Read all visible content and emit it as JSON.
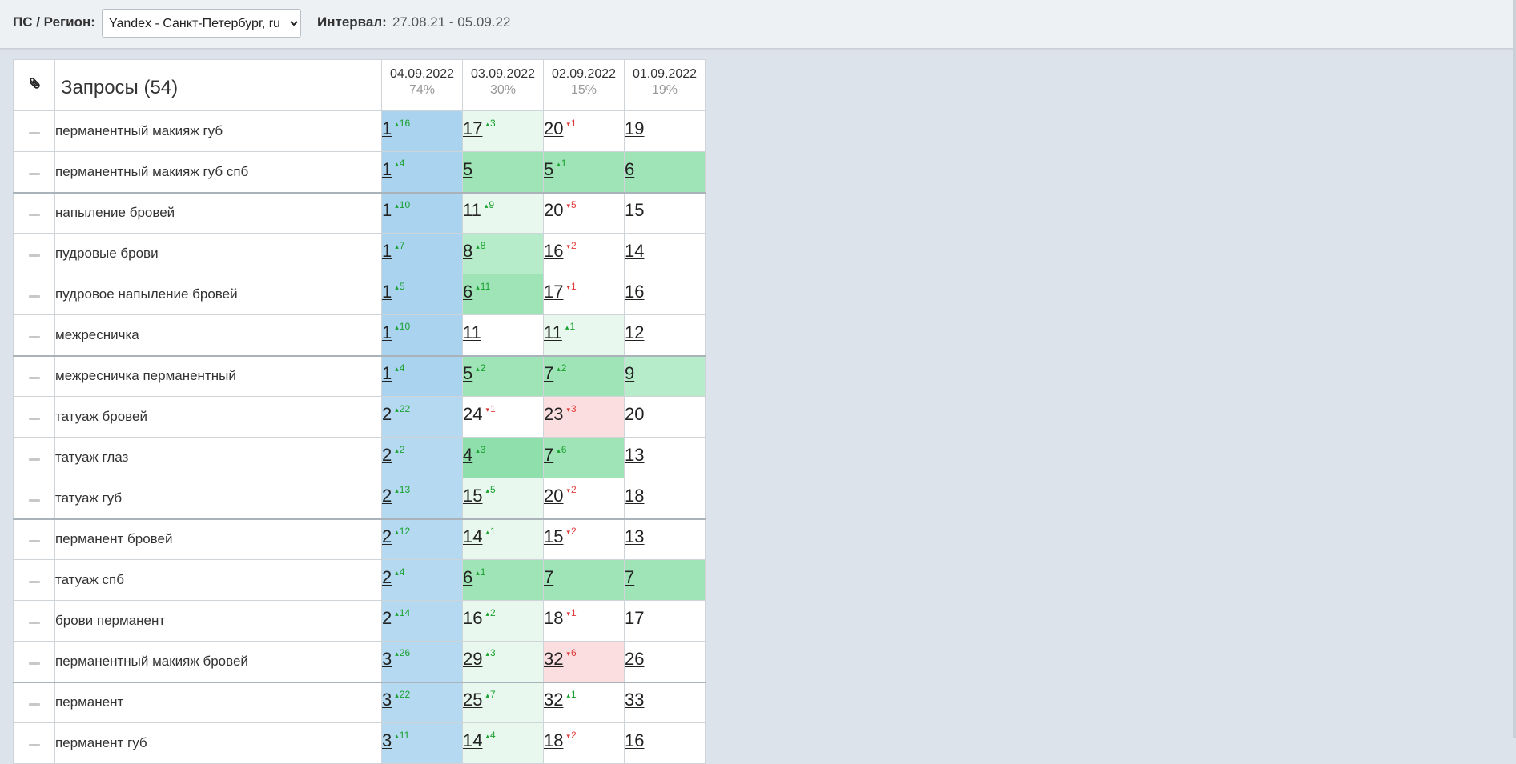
{
  "toolbar": {
    "region_label": "ПС / Регион:",
    "region_value": "Yandex - Санкт-Петербург, ru",
    "interval_label": "Интервал:",
    "interval_value": "27.08.21 - 05.09.22"
  },
  "table": {
    "attach_icon": "paperclip-icon",
    "query_header": "Запросы (54)",
    "columns": [
      {
        "date": "04.09.2022",
        "pct": "74%"
      },
      {
        "date": "03.09.2022",
        "pct": "30%"
      },
      {
        "date": "02.09.2022",
        "pct": "15%"
      },
      {
        "date": "01.09.2022",
        "pct": "19%"
      }
    ],
    "rows": [
      {
        "query": "перманентный макияж губ",
        "group_start": false,
        "cells": [
          {
            "v": "1",
            "d": "16",
            "dir": "up",
            "bg": "top"
          },
          {
            "v": "17",
            "d": "3",
            "dir": "up",
            "bg": "g5"
          },
          {
            "v": "20",
            "d": "1",
            "dir": "dn",
            "bg": "white"
          },
          {
            "v": "19",
            "d": "",
            "dir": "",
            "bg": "white"
          }
        ]
      },
      {
        "query": "перманентный макияж губ спб",
        "group_start": false,
        "cells": [
          {
            "v": "1",
            "d": "4",
            "dir": "up",
            "bg": "top"
          },
          {
            "v": "5",
            "d": "",
            "dir": "",
            "bg": "g2"
          },
          {
            "v": "5",
            "d": "1",
            "dir": "up",
            "bg": "g2"
          },
          {
            "v": "6",
            "d": "",
            "dir": "",
            "bg": "g2"
          }
        ]
      },
      {
        "query": "напыление бровей",
        "group_start": true,
        "cells": [
          {
            "v": "1",
            "d": "10",
            "dir": "up",
            "bg": "top"
          },
          {
            "v": "11",
            "d": "9",
            "dir": "up",
            "bg": "g5"
          },
          {
            "v": "20",
            "d": "5",
            "dir": "dn",
            "bg": "white"
          },
          {
            "v": "15",
            "d": "",
            "dir": "",
            "bg": "white"
          }
        ]
      },
      {
        "query": "пудровые брови",
        "group_start": false,
        "cells": [
          {
            "v": "1",
            "d": "7",
            "dir": "up",
            "bg": "top"
          },
          {
            "v": "8",
            "d": "8",
            "dir": "up",
            "bg": "g3"
          },
          {
            "v": "16",
            "d": "2",
            "dir": "dn",
            "bg": "white"
          },
          {
            "v": "14",
            "d": "",
            "dir": "",
            "bg": "white"
          }
        ]
      },
      {
        "query": "пудровое напыление бровей",
        "group_start": false,
        "cells": [
          {
            "v": "1",
            "d": "5",
            "dir": "up",
            "bg": "top"
          },
          {
            "v": "6",
            "d": "11",
            "dir": "up",
            "bg": "g2"
          },
          {
            "v": "17",
            "d": "1",
            "dir": "dn",
            "bg": "white"
          },
          {
            "v": "16",
            "d": "",
            "dir": "",
            "bg": "white"
          }
        ]
      },
      {
        "query": "межресничка",
        "group_start": false,
        "cells": [
          {
            "v": "1",
            "d": "10",
            "dir": "up",
            "bg": "top"
          },
          {
            "v": "11",
            "d": "",
            "dir": "",
            "bg": "white"
          },
          {
            "v": "11",
            "d": "1",
            "dir": "up",
            "bg": "g5"
          },
          {
            "v": "12",
            "d": "",
            "dir": "",
            "bg": "white"
          }
        ]
      },
      {
        "query": "межресничка перманентный",
        "group_start": true,
        "cells": [
          {
            "v": "1",
            "d": "4",
            "dir": "up",
            "bg": "top"
          },
          {
            "v": "5",
            "d": "2",
            "dir": "up",
            "bg": "g2"
          },
          {
            "v": "7",
            "d": "2",
            "dir": "up",
            "bg": "g2"
          },
          {
            "v": "9",
            "d": "",
            "dir": "",
            "bg": "g3"
          }
        ]
      },
      {
        "query": "татуаж бровей",
        "group_start": false,
        "cells": [
          {
            "v": "2",
            "d": "22",
            "dir": "up",
            "bg": "top2"
          },
          {
            "v": "24",
            "d": "1",
            "dir": "dn",
            "bg": "white"
          },
          {
            "v": "23",
            "d": "3",
            "dir": "dn",
            "bg": "red"
          },
          {
            "v": "20",
            "d": "",
            "dir": "",
            "bg": "white"
          }
        ]
      },
      {
        "query": "татуаж глаз",
        "group_start": false,
        "cells": [
          {
            "v": "2",
            "d": "2",
            "dir": "up",
            "bg": "top2"
          },
          {
            "v": "4",
            "d": "3",
            "dir": "up",
            "bg": "g1"
          },
          {
            "v": "7",
            "d": "6",
            "dir": "up",
            "bg": "g2"
          },
          {
            "v": "13",
            "d": "",
            "dir": "",
            "bg": "white"
          }
        ]
      },
      {
        "query": "татуаж губ",
        "group_start": false,
        "cells": [
          {
            "v": "2",
            "d": "13",
            "dir": "up",
            "bg": "top2"
          },
          {
            "v": "15",
            "d": "5",
            "dir": "up",
            "bg": "g5"
          },
          {
            "v": "20",
            "d": "2",
            "dir": "dn",
            "bg": "white"
          },
          {
            "v": "18",
            "d": "",
            "dir": "",
            "bg": "white"
          }
        ]
      },
      {
        "query": "перманент бровей",
        "group_start": true,
        "cells": [
          {
            "v": "2",
            "d": "12",
            "dir": "up",
            "bg": "top2"
          },
          {
            "v": "14",
            "d": "1",
            "dir": "up",
            "bg": "g5"
          },
          {
            "v": "15",
            "d": "2",
            "dir": "dn",
            "bg": "white"
          },
          {
            "v": "13",
            "d": "",
            "dir": "",
            "bg": "white"
          }
        ]
      },
      {
        "query": "татуаж спб",
        "group_start": false,
        "cells": [
          {
            "v": "2",
            "d": "4",
            "dir": "up",
            "bg": "top2"
          },
          {
            "v": "6",
            "d": "1",
            "dir": "up",
            "bg": "g2"
          },
          {
            "v": "7",
            "d": "",
            "dir": "",
            "bg": "g2"
          },
          {
            "v": "7",
            "d": "",
            "dir": "",
            "bg": "g2"
          }
        ]
      },
      {
        "query": "брови перманент",
        "group_start": false,
        "cells": [
          {
            "v": "2",
            "d": "14",
            "dir": "up",
            "bg": "top2"
          },
          {
            "v": "16",
            "d": "2",
            "dir": "up",
            "bg": "g5"
          },
          {
            "v": "18",
            "d": "1",
            "dir": "dn",
            "bg": "white"
          },
          {
            "v": "17",
            "d": "",
            "dir": "",
            "bg": "white"
          }
        ]
      },
      {
        "query": "перманентный макияж бровей",
        "group_start": false,
        "cells": [
          {
            "v": "3",
            "d": "26",
            "dir": "up",
            "bg": "top2"
          },
          {
            "v": "29",
            "d": "3",
            "dir": "up",
            "bg": "g5"
          },
          {
            "v": "32",
            "d": "6",
            "dir": "dn",
            "bg": "red"
          },
          {
            "v": "26",
            "d": "",
            "dir": "",
            "bg": "white"
          }
        ]
      },
      {
        "query": "перманент",
        "group_start": true,
        "cells": [
          {
            "v": "3",
            "d": "22",
            "dir": "up",
            "bg": "top2"
          },
          {
            "v": "25",
            "d": "7",
            "dir": "up",
            "bg": "g5"
          },
          {
            "v": "32",
            "d": "1",
            "dir": "up",
            "bg": "white"
          },
          {
            "v": "33",
            "d": "",
            "dir": "",
            "bg": "white"
          }
        ]
      },
      {
        "query": "перманент губ",
        "group_start": false,
        "cells": [
          {
            "v": "3",
            "d": "11",
            "dir": "up",
            "bg": "top2"
          },
          {
            "v": "14",
            "d": "4",
            "dir": "up",
            "bg": "g5"
          },
          {
            "v": "18",
            "d": "2",
            "dir": "dn",
            "bg": "white"
          },
          {
            "v": "16",
            "d": "",
            "dir": "",
            "bg": "white"
          }
        ]
      }
    ]
  }
}
